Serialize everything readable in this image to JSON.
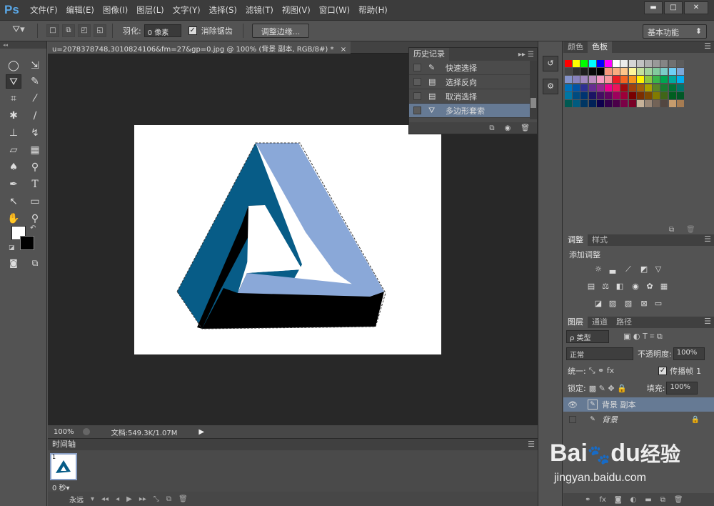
{
  "app": {
    "logo": "Ps"
  },
  "menu": [
    "文件(F)",
    "编辑(E)",
    "图像(I)",
    "图层(L)",
    "文字(Y)",
    "选择(S)",
    "滤镜(T)",
    "视图(V)",
    "窗口(W)",
    "帮助(H)"
  ],
  "window_buttons": [
    "▬",
    "□",
    "✕"
  ],
  "options": {
    "feather_label": "羽化:",
    "feather_value": "0 像素",
    "antialias_label": "消除锯齿",
    "refine_edge": "调整边缘...",
    "workspace": "基本功能"
  },
  "document": {
    "tab_title": "u=2078378748,3010824106&fm=27&gp=0.jpg @ 100% (背景 副本, RGB/8#) *",
    "zoom": "100%",
    "doc_size": "文档:549.3K/1.07M"
  },
  "history": {
    "tab": "历史记录",
    "items": [
      {
        "label": "快速选择",
        "icon": "quick-select-icon"
      },
      {
        "label": "选择反向",
        "icon": "document-icon"
      },
      {
        "label": "取消选择",
        "icon": "document-icon"
      },
      {
        "label": "多边形套索",
        "icon": "polygon-lasso-icon"
      }
    ],
    "selected_index": 3
  },
  "timeline": {
    "tab": "时间轴",
    "frame_number": "1",
    "frame_delay": "0 秒▾",
    "loop": "永远"
  },
  "swatches_panel": {
    "tabs": [
      "颜色",
      "色板"
    ],
    "active": "色板"
  },
  "adjustments_panel": {
    "tabs": [
      "调整",
      "样式"
    ],
    "title": "添加调整"
  },
  "layers_panel": {
    "tabs": [
      "图层",
      "通道",
      "路径"
    ],
    "filter_label": "ρ 类型",
    "blend_mode": "正常",
    "opacity_label": "不透明度:",
    "opacity_value": "100%",
    "unify_label": "统一:",
    "propagate_label": "传播帧",
    "propagate_value": "1",
    "lock_label": "锁定:",
    "fill_label": "填充:",
    "fill_value": "100%",
    "layers": [
      {
        "name": "背景 副本",
        "visible": true,
        "selected": true
      },
      {
        "name": "背景",
        "visible": false,
        "selected": false
      }
    ]
  },
  "watermark": {
    "brand": "Bai",
    "brand2": "du",
    "cn": "经验",
    "url": "jingyan.baidu.com"
  },
  "colors": {
    "selection_blue": "#667a94",
    "triangle_dark": "#075c87",
    "triangle_light": "#8aa8d8",
    "triangle_black": "#000000",
    "swatches": [
      [
        "#ff0000",
        "#ffff00",
        "#00ff00",
        "#00ffff",
        "#0000ff",
        "#ff00ff",
        "#ffffff",
        "#ebebeb",
        "#d6d6d6",
        "#c2c2c2",
        "#adadad",
        "#999999",
        "#858585",
        "#707070",
        "#5c5c5c"
      ],
      [
        "#474747",
        "#333333",
        "#1f1f1f",
        "#0a0a0a",
        "#000000",
        "#f7977a",
        "#f9ad81",
        "#fdc68a",
        "#fff79a",
        "#c4df9b",
        "#a2d39c",
        "#82ca9d",
        "#7bcdc8",
        "#6ecff6",
        "#7ea7d8"
      ],
      [
        "#8493ca",
        "#8882be",
        "#a187be",
        "#bc8dbf",
        "#f49ac2",
        "#f6989d",
        "#ed1c24",
        "#f26522",
        "#f7941d",
        "#fff200",
        "#8dc63f",
        "#39b54a",
        "#00a651",
        "#00a99d",
        "#00aeef"
      ],
      [
        "#0072bc",
        "#0054a6",
        "#2e3192",
        "#662d91",
        "#92278f",
        "#ec008c",
        "#ed145b",
        "#9e0b0f",
        "#a0410d",
        "#a36209",
        "#aba000",
        "#598527",
        "#1a7b30",
        "#007236",
        "#00746b"
      ],
      [
        "#0076a3",
        "#004b80",
        "#003471",
        "#1b1464",
        "#440e62",
        "#630460",
        "#9e005d",
        "#9e0039",
        "#790000",
        "#7b2e00",
        "#7d4900",
        "#827b00",
        "#406618",
        "#005e20",
        "#005826"
      ],
      [
        "#005952",
        "#005b7f",
        "#003663",
        "#002157",
        "#0d004c",
        "#32004b",
        "#4b0049",
        "#7b0046",
        "#7a0026",
        "#c7b299",
        "#998675",
        "#736357",
        "#534741",
        "#c69c6d",
        "#a67c52"
      ]
    ]
  }
}
